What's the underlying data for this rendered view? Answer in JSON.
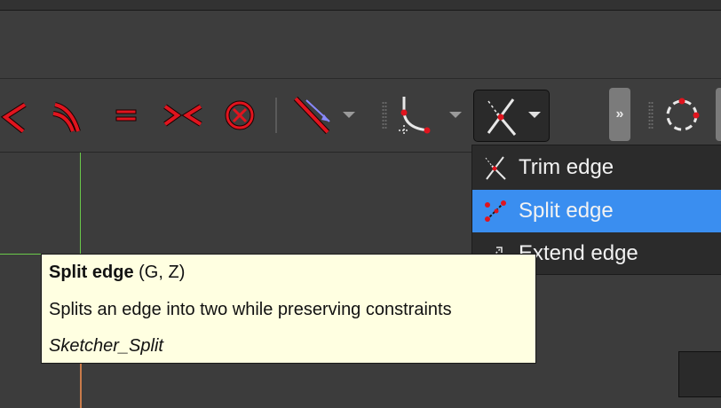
{
  "toolbar": {
    "icons": [
      {
        "name": "tangent-constraint-icon"
      },
      {
        "name": "coincident-curves-icon"
      },
      {
        "name": "equal-constraint-icon"
      },
      {
        "name": "symmetric-constraint-icon"
      },
      {
        "name": "block-constraint-icon"
      },
      {
        "name": "distance-constraint-icon"
      },
      {
        "name": "fillet-icon"
      },
      {
        "name": "trim-edge-icon"
      },
      {
        "name": "more-icon"
      },
      {
        "name": "circle-construction-icon"
      }
    ],
    "overflow_label": "»"
  },
  "menu": {
    "items": [
      {
        "label": "Trim edge",
        "icon": "trim-edge-icon",
        "selected": false
      },
      {
        "label": "Split edge",
        "icon": "split-edge-icon",
        "selected": true
      },
      {
        "label": "Extend edge",
        "icon": "extend-edge-icon",
        "selected": false
      }
    ]
  },
  "tooltip": {
    "title": "Split edge",
    "shortcut": "(G, Z)",
    "description": "Splits an edge into two while preserving constraints",
    "command": "Sketcher_Split"
  },
  "colors": {
    "accent": "#3a8ef0",
    "icon_red": "#e0141e",
    "tooltip_bg": "#ffffe1",
    "background": "#3d3d3d"
  }
}
